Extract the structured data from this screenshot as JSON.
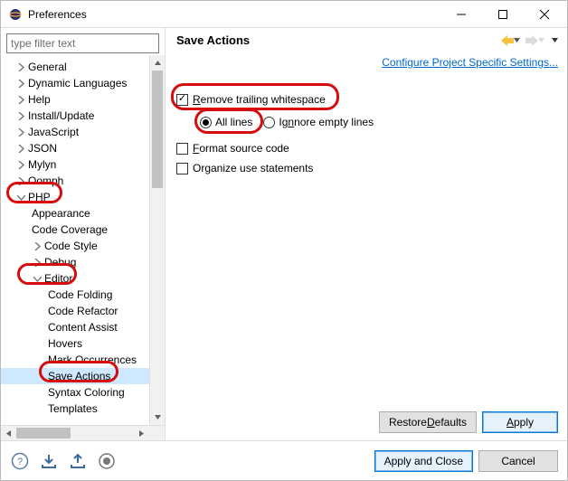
{
  "window": {
    "title": "Preferences"
  },
  "sidebar": {
    "filter_placeholder": "type filter text",
    "items": {
      "general": "General",
      "dynlang": "Dynamic Languages",
      "help": "Help",
      "install": "Install/Update",
      "javascript": "JavaScript",
      "json": "JSON",
      "mylyn": "Mylyn",
      "oomph": "Oomph",
      "php": "PHP",
      "appearance": "Appearance",
      "coverage": "Code Coverage",
      "codestyle": "Code Style",
      "debug": "Debug",
      "editor": "Editor",
      "codefolding": "Code Folding",
      "coderefactor": "Code Refactor",
      "contentassist": "Content Assist",
      "hovers": "Hovers",
      "markocc": "Mark Occurrences",
      "saveactions": "Save Actions",
      "syntax": "Syntax Coloring",
      "templates": "Templates"
    }
  },
  "main": {
    "title": "Save Actions",
    "project_link": "Configure Project Specific Settings...",
    "remove_ws_pre": "R",
    "remove_ws_rest": "emove trailing whitespace",
    "all_lines": "All lines",
    "ignore_empty": "Ig",
    "ignore_empty_rest": "nore empty lines",
    "format_pre": "F",
    "format_rest": "ormat source code",
    "organize": "Organize use statements",
    "restore": "Restore ",
    "restore_u": "D",
    "restore_rest": "efaults",
    "apply_u": "A",
    "apply_rest": "pply"
  },
  "footer": {
    "apply_close": "Apply and Close",
    "cancel": "Cancel"
  }
}
